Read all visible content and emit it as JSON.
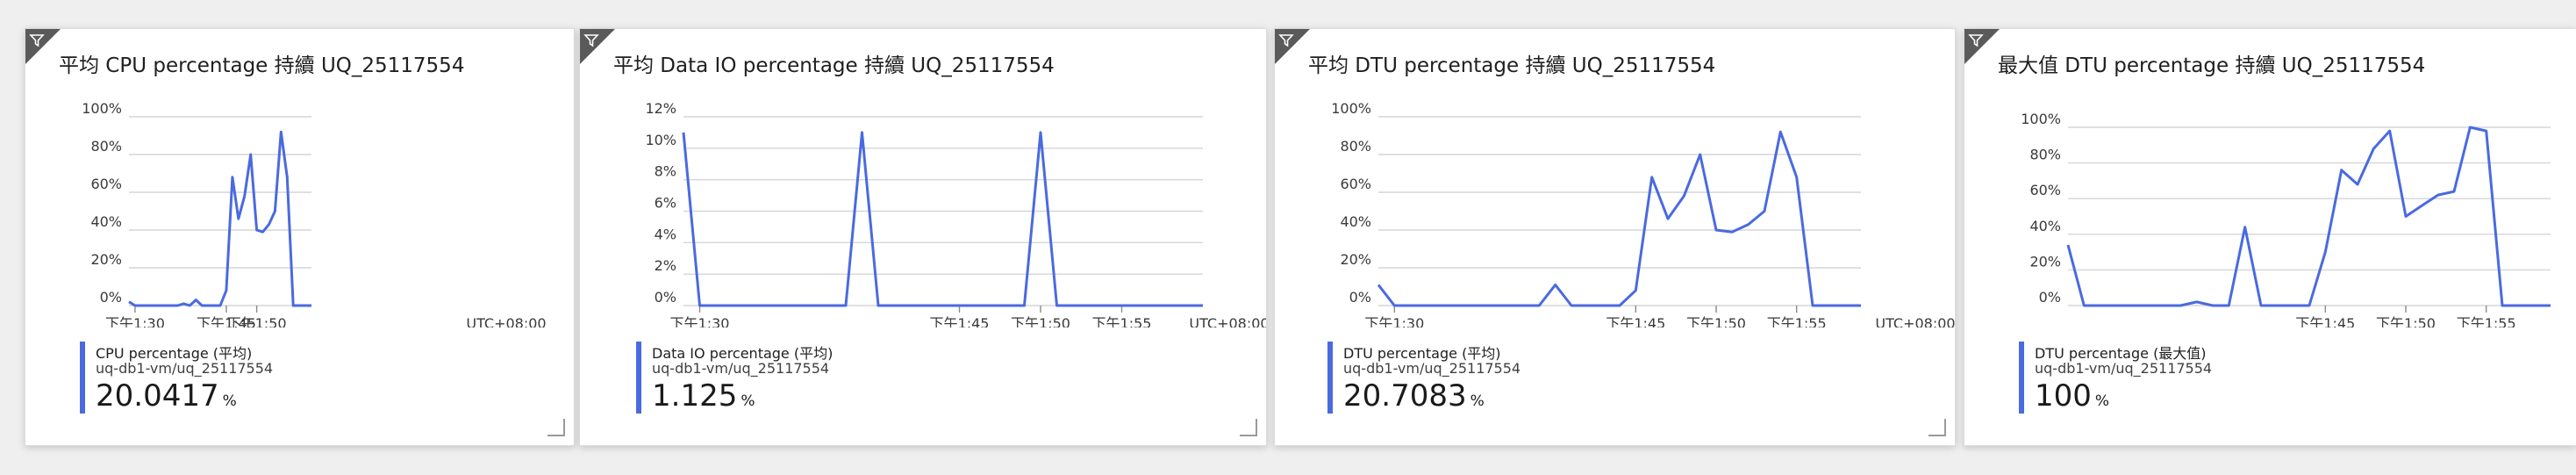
{
  "tiles": [
    {
      "title": "平均 CPU percentage 持續 UQ_25117554",
      "legend": {
        "name": "CPU percentage (平均)",
        "resource": "uq-db1-vm/uq_25117554",
        "value": "20.0417",
        "unit": "%"
      }
    },
    {
      "title": "平均 Data IO percentage 持續 UQ_25117554",
      "legend": {
        "name": "Data IO percentage (平均)",
        "resource": "uq-db1-vm/uq_25117554",
        "value": "1.125",
        "unit": "%"
      }
    },
    {
      "title": "平均 DTU percentage 持續 UQ_25117554",
      "legend": {
        "name": "DTU percentage (平均)",
        "resource": "uq-db1-vm/uq_25117554",
        "value": "20.7083",
        "unit": "%"
      }
    },
    {
      "title": "最大值 DTU percentage 持續 UQ_25117554",
      "legend": {
        "name": "DTU percentage (最大值)",
        "resource": "uq-db1-vm/uq_25117554",
        "value": "100",
        "unit": "%"
      }
    }
  ],
  "colors": {
    "line": "#4a6ae0",
    "grid": "#d6d6d6",
    "axis_text": "#3a3a3a",
    "filter_corner": "#5a5a5a"
  },
  "chart_data": [
    {
      "type": "line",
      "series": [
        {
          "name": "CPU percentage (平均)",
          "values": [
            2,
            0,
            0,
            0,
            0,
            0,
            0,
            0,
            0,
            1,
            0,
            3,
            0,
            0,
            0,
            0,
            8,
            68,
            46,
            58,
            80,
            40,
            39,
            43,
            50,
            92,
            68,
            0,
            0,
            0,
            0
          ]
        }
      ],
      "ylim": [
        0,
        100
      ],
      "y_ticks": [
        "100%",
        "80%",
        "60%",
        "40%",
        "20%",
        "0%"
      ],
      "x_ticks": [
        {
          "label": "下午1:30",
          "x": 1
        },
        {
          "label": "下午1:45",
          "x": 16
        },
        {
          "label": "下午1:50",
          "x": 21
        }
      ],
      "timezone_label": "UTC+08:00"
    },
    {
      "type": "line",
      "series": [
        {
          "name": "Data IO percentage (平均)",
          "values": [
            11,
            0,
            0,
            0,
            0,
            0,
            0,
            0,
            0,
            0,
            0,
            11,
            0,
            0,
            0,
            0,
            0,
            0,
            0,
            0,
            0,
            0,
            11,
            0,
            0,
            0,
            0,
            0,
            0,
            0,
            0,
            0,
            0
          ]
        }
      ],
      "ylim": [
        0,
        12
      ],
      "y_ticks": [
        "12%",
        "10%",
        "8%",
        "6%",
        "4%",
        "2%",
        "0%"
      ],
      "x_ticks": [
        {
          "label": "下午1:30",
          "x": 1
        },
        {
          "label": "下午1:45",
          "x": 17
        },
        {
          "label": "下午1:50",
          "x": 22
        },
        {
          "label": "下午1:55",
          "x": 27
        }
      ],
      "timezone_label": "UTC+08:00"
    },
    {
      "type": "line",
      "series": [
        {
          "name": "DTU percentage (平均)",
          "values": [
            11,
            0,
            0,
            0,
            0,
            0,
            0,
            0,
            0,
            0,
            0,
            11,
            0,
            0,
            0,
            0,
            8,
            68,
            46,
            58,
            80,
            40,
            39,
            43,
            50,
            92,
            68,
            0,
            0,
            0,
            0
          ]
        }
      ],
      "ylim": [
        0,
        100
      ],
      "y_ticks": [
        "100%",
        "80%",
        "60%",
        "40%",
        "20%",
        "0%"
      ],
      "x_ticks": [
        {
          "label": "下午1:30",
          "x": 1
        },
        {
          "label": "下午1:45",
          "x": 16
        },
        {
          "label": "下午1:50",
          "x": 21
        },
        {
          "label": "下午1:55",
          "x": 26
        }
      ],
      "timezone_label": "UTC+08:00"
    },
    {
      "type": "line",
      "series": [
        {
          "name": "DTU percentage (最大值)",
          "values": [
            34,
            0,
            0,
            0,
            0,
            0,
            0,
            0,
            2,
            0,
            0,
            44,
            0,
            0,
            0,
            0,
            30,
            76,
            68,
            88,
            98,
            50,
            56,
            62,
            64,
            100,
            98,
            0,
            0,
            0,
            0
          ]
        }
      ],
      "ylim": [
        0,
        100
      ],
      "y_ticks": [
        "100%",
        "80%",
        "60%",
        "40%",
        "20%",
        "0%"
      ],
      "x_ticks": [
        {
          "label": "下午1:45",
          "x": 16
        },
        {
          "label": "下午1:50",
          "x": 21
        },
        {
          "label": "下午1:55",
          "x": 26
        }
      ]
    }
  ]
}
